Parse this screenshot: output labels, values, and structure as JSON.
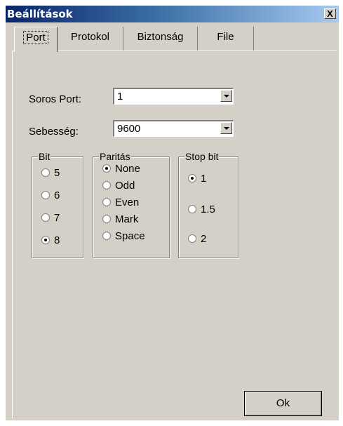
{
  "window": {
    "title": "Beállítások",
    "close_glyph": "X"
  },
  "tabs": [
    {
      "label": "Port",
      "active": true
    },
    {
      "label": "Protokol",
      "active": false
    },
    {
      "label": "Biztonság",
      "active": false
    },
    {
      "label": "File",
      "active": false
    }
  ],
  "serial": {
    "port_label": "Soros Port:",
    "port_value": "1",
    "speed_label": "Sebesség:",
    "speed_value": "9600"
  },
  "groups": {
    "bit": {
      "title": "Bit",
      "options": [
        "5",
        "6",
        "7",
        "8"
      ],
      "selected": "8"
    },
    "parity": {
      "title": "Paritás",
      "options": [
        "None",
        "Odd",
        "Even",
        "Mark",
        "Space"
      ],
      "selected": "None"
    },
    "stopbit": {
      "title": "Stop bit",
      "options": [
        "1",
        "1.5",
        "2"
      ],
      "selected": "1"
    }
  },
  "buttons": {
    "ok_label": "Ok"
  }
}
